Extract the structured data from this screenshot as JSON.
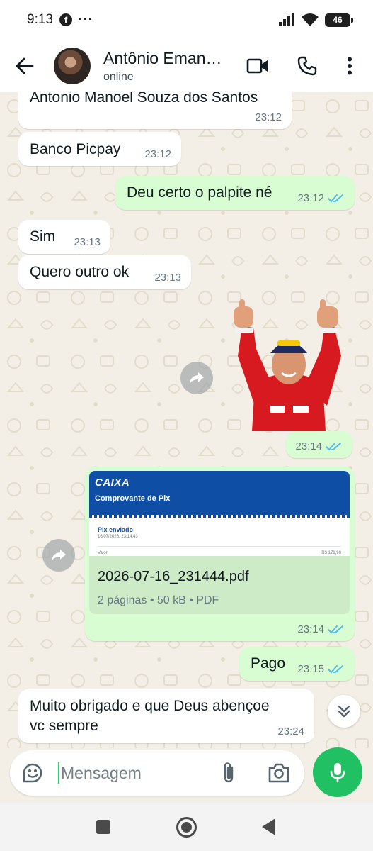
{
  "status_bar": {
    "time": "9:13",
    "notification_icon": "facebook-icon",
    "more_indicator": "···",
    "battery_level": "46",
    "icons": [
      "signal-icon",
      "wifi-icon",
      "battery-icon"
    ]
  },
  "header": {
    "contact_name": "Antônio Eman…",
    "contact_status": "online",
    "actions": [
      "video-call-icon",
      "voice-call-icon",
      "more-options-icon"
    ]
  },
  "messages": [
    {
      "dir": "in",
      "text": "Antonio Manoel Souza dos Santos",
      "time": "23:12"
    },
    {
      "dir": "in",
      "text": "Banco Picpay",
      "time": "23:12"
    },
    {
      "dir": "out",
      "text": "Deu certo o palpite né",
      "time": "23:12",
      "read": true
    },
    {
      "dir": "in",
      "text": "Sim",
      "time": "23:13"
    },
    {
      "dir": "in",
      "text": "Quero outro ok",
      "time": "23:13"
    },
    {
      "dir": "out",
      "type": "sticker",
      "time": "23:14",
      "read": true
    },
    {
      "dir": "out",
      "type": "document",
      "time": "23:14",
      "read": true,
      "preview": {
        "brand": "CAIXA",
        "heading": "Comprovante de Pix",
        "line1": "Pix enviado",
        "line2": "16/07/2026, 23:14:43",
        "label": "Valor",
        "amount": "R$ 171,90"
      },
      "filename": "2026-07-16_231444.pdf",
      "details": "2 páginas • 50 kB • PDF"
    },
    {
      "dir": "out",
      "text": "Pago",
      "time": "23:15",
      "read": true
    },
    {
      "dir": "in",
      "text_line1": "Muito obrigado e que Deus abençoe",
      "text_line2": "vc sempre",
      "time": "23:24"
    }
  ],
  "composer": {
    "placeholder": "Mensagem",
    "icons": [
      "sticker-icon",
      "attach-icon",
      "camera-icon",
      "mic-icon"
    ]
  },
  "colors": {
    "accent": "#21c063",
    "outgoing_bubble": "#d9fdd3",
    "incoming_bubble": "#ffffff",
    "read_tick": "#53bdeb",
    "chat_background": "#f4efe6",
    "caixa_blue": "#0e4fa5"
  }
}
